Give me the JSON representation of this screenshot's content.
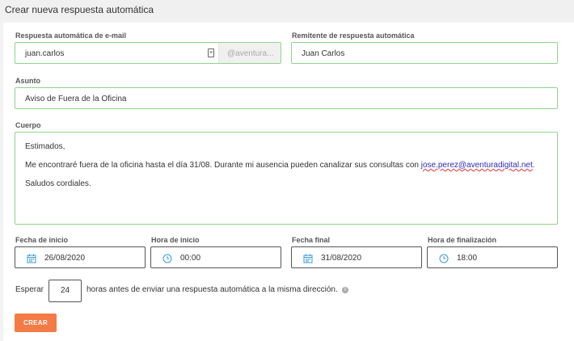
{
  "page_title": "Crear nueva respuesta automática",
  "email_field": {
    "label": "Respuesta automática de e-mail",
    "value": "juan.carlos",
    "domain_addon": "@aventura..."
  },
  "sender_field": {
    "label": "Remitente de respuesta automática",
    "value": "Juan Carlos"
  },
  "subject_field": {
    "label": "Asunto",
    "value": "Aviso de Fuera de la Oficina"
  },
  "body_field": {
    "label": "Cuerpo",
    "line1": "Estimados,",
    "line2_prefix": "Me encontraré fuera de la oficina hasta el día 31/08. Durante mi ausencia pueden canalizar sus consultas con ",
    "line2_email": "jose.perez@aventuradigital.net",
    "line2_suffix": ".",
    "line3": "Saludos cordiales."
  },
  "start_date": {
    "label": "Fecha de inicio",
    "value": "26/08/2020"
  },
  "start_time": {
    "label": "Hora de inicio",
    "value": "00:00"
  },
  "end_date": {
    "label": "Fecha final",
    "value": "31/08/2020"
  },
  "end_time": {
    "label": "Hora de finalización",
    "value": "18:00"
  },
  "wait": {
    "prefix": "Esperar",
    "hours": "24",
    "suffix": "horas antes de enviar una respuesta automática a la misma dirección."
  },
  "create_button": "CREAR",
  "colors": {
    "accent": "#f47a46",
    "valid_border": "#8fd48a",
    "icon_blue": "#3a9ad9"
  }
}
